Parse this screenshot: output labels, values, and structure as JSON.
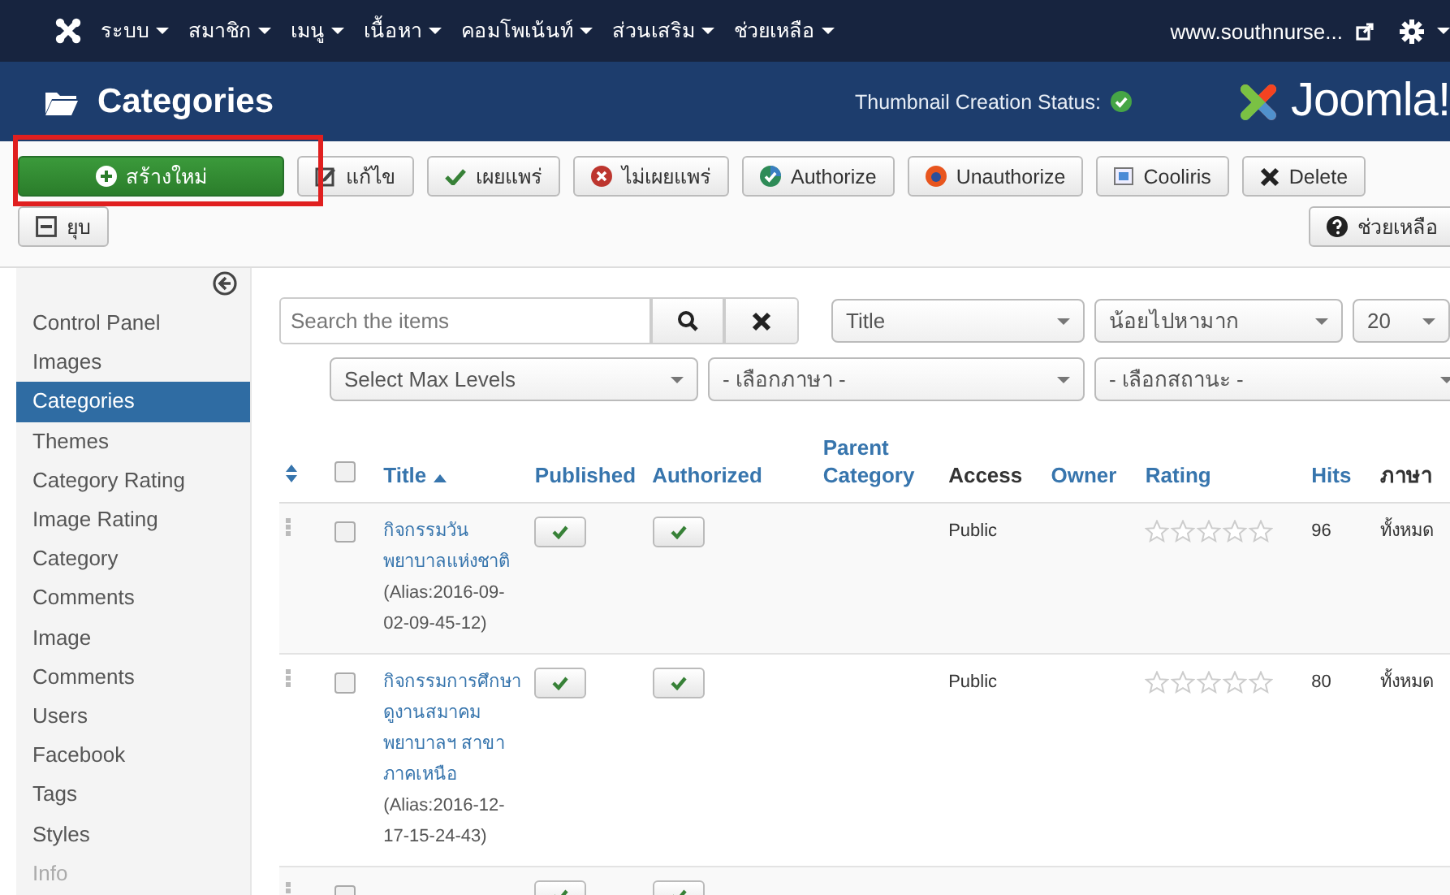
{
  "top_menu": {
    "items": [
      {
        "label": "ระบบ"
      },
      {
        "label": "สมาชิก"
      },
      {
        "label": "เมนู"
      },
      {
        "label": "เนื้อหา"
      },
      {
        "label": "คอมโพเน้นท์"
      },
      {
        "label": "ส่วนเสริม"
      },
      {
        "label": "ช่วยเหลือ"
      }
    ],
    "site_link": "www.southnurse..."
  },
  "header": {
    "title": "Categories",
    "thumbnail_status_label": "Thumbnail Creation Status:",
    "thumbnail_status_ok": true,
    "logo_text": "Joomla!"
  },
  "toolbar": {
    "buttons": [
      {
        "label": "สร้างใหม่",
        "kind": "new",
        "highlighted": true
      },
      {
        "label": "แก้ไข",
        "kind": "edit",
        "highlighted": false
      },
      {
        "label": "เผยแพร่",
        "kind": "publish",
        "highlighted": false
      },
      {
        "label": "ไม่เผยแพร่",
        "kind": "unpublish",
        "highlighted": false
      },
      {
        "label": "Authorize",
        "kind": "authorize",
        "highlighted": false
      },
      {
        "label": "Unauthorize",
        "kind": "unauthorize",
        "highlighted": false
      },
      {
        "label": "Cooliris",
        "kind": "cooliris",
        "highlighted": false
      },
      {
        "label": "Delete",
        "kind": "delete",
        "highlighted": false
      },
      {
        "label": "ยุบ",
        "kind": "collapse",
        "highlighted": false
      }
    ],
    "help_button": "ช่วยเหลือ"
  },
  "sidebar": {
    "items": [
      {
        "label": "Control Panel",
        "selected": false,
        "disabled": false
      },
      {
        "label": "Images",
        "selected": false,
        "disabled": false
      },
      {
        "label": "Categories",
        "selected": true,
        "disabled": false
      },
      {
        "label": "Themes",
        "selected": false,
        "disabled": false
      },
      {
        "label": "Category Rating",
        "selected": false,
        "disabled": false
      },
      {
        "label": "Image Rating",
        "selected": false,
        "disabled": false
      },
      {
        "label": "Category Comments",
        "selected": false,
        "disabled": false
      },
      {
        "label": "Image Comments",
        "selected": false,
        "disabled": false
      },
      {
        "label": "Users",
        "selected": false,
        "disabled": false
      },
      {
        "label": "Facebook",
        "selected": false,
        "disabled": false
      },
      {
        "label": "Tags",
        "selected": false,
        "disabled": false
      },
      {
        "label": "Styles",
        "selected": false,
        "disabled": false
      },
      {
        "label": "Info",
        "selected": false,
        "disabled": true
      }
    ]
  },
  "filters": {
    "search": {
      "placeholder": "Search the items"
    },
    "sort_selects": [
      {
        "value": "Title"
      },
      {
        "value": "น้อยไปหามาก"
      },
      {
        "value": "20"
      }
    ],
    "filter_selects": [
      {
        "value": "Select Max Levels"
      },
      {
        "value": "- เลือกภาษา -"
      },
      {
        "value": "- เลือกสถานะ -"
      }
    ]
  },
  "table": {
    "columns": [
      {
        "kind": "ordering"
      },
      {
        "kind": "checkbox",
        "checked": false
      },
      {
        "kind": "text",
        "label": "Title",
        "link": true,
        "sorted": true
      },
      {
        "kind": "text",
        "label": "Published",
        "link": true,
        "sorted": false
      },
      {
        "kind": "text",
        "label": "Authorized",
        "link": true,
        "sorted": false
      },
      {
        "kind": "text",
        "label": "Parent Category",
        "link": true,
        "sorted": false
      },
      {
        "kind": "text",
        "label": "Access",
        "link": false,
        "sorted": false
      },
      {
        "kind": "text",
        "label": "Owner",
        "link": true,
        "sorted": false
      },
      {
        "kind": "text",
        "label": "Rating",
        "link": true,
        "sorted": false
      },
      {
        "kind": "text",
        "label": "Hits",
        "link": true,
        "sorted": false
      },
      {
        "kind": "text",
        "label": "ภาษา",
        "link": false,
        "sorted": false
      }
    ],
    "rows": [
      {
        "checked": false,
        "title": "กิจกรรมวันพยาบาลแห่งชาติ",
        "alias": "(Alias:2016-09-02-09-45-12)",
        "published": true,
        "authorized": true,
        "access": "Public",
        "stars": 0,
        "hits": "96",
        "language": "ทั้งหมด"
      },
      {
        "checked": false,
        "title": "กิจกรรมการศึกษาดูงานสมาคมพยาบาลฯ สาขาภาคเหนือ",
        "alias": "(Alias:2016-12-17-15-24-43)",
        "published": true,
        "authorized": true,
        "access": "Public",
        "stars": 0,
        "hits": "80",
        "language": "ทั้งหมด"
      },
      {
        "checked": false,
        "published": true,
        "authorized": true
      }
    ]
  }
}
